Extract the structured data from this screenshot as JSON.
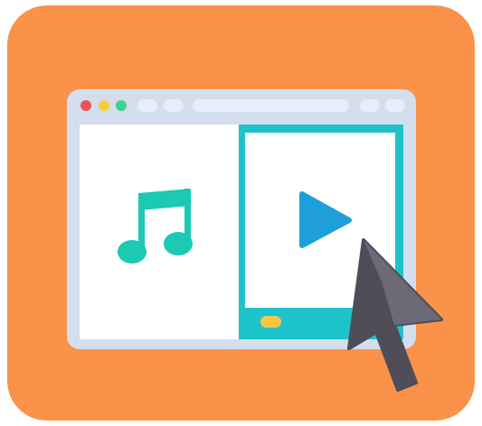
{
  "colors": {
    "tile_background": "#FB9249",
    "window_frame": "#D3DEEE",
    "window_chrome_pill": "#E8EEF7",
    "window_pane": "#FFFFFF",
    "close_dot": "#F0505A",
    "minimize_dot": "#F7CE3E",
    "maximize_dot": "#3ED28E",
    "music_note": "#1BC9B4",
    "tablet_body": "#1CC3CB",
    "tablet_screen": "#FFFFFF",
    "play_triangle": "#1E9FD9",
    "home_button": "#F6C644",
    "cursor_dark": "#4F4D58",
    "cursor_light": "#6C6A76"
  },
  "icons": {
    "music": "music-note-icon",
    "play": "play-icon",
    "cursor": "mouse-pointer-icon"
  }
}
